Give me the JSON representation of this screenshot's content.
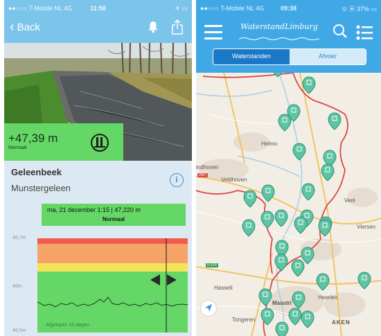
{
  "detail": {
    "status_bar": {
      "carrier": "●●○○○ T-Mobile NL  4G",
      "time": "11:58",
      "right": "✈ ▭"
    },
    "nav": {
      "back_label": "Back",
      "icons": [
        "bell-icon",
        "share-icon"
      ]
    },
    "level": {
      "value": "+47,39 m",
      "status": "Normaal"
    },
    "station": {
      "river": "Geleenbeek",
      "place": "Munstergeleen"
    },
    "tooltip": {
      "date_value": "ma, 21 december 1:15 |   47,220 m",
      "status": "Normaal"
    },
    "chart": {
      "y_labels": [
        "48,7m",
        "48m",
        "46,5m"
      ],
      "footer": "Afgelopen 10 dagen",
      "colors": {
        "red": "#f05b4e",
        "orange": "#f6a368",
        "yellow": "#f4e45a",
        "green": "#64d767"
      }
    }
  },
  "map_screen": {
    "status_bar": {
      "carrier": "●●○○○ T-Mobile NL  4G",
      "time": "09:38",
      "right": "⊙ ⦿ 37% ▭"
    },
    "logo": "WaterstandLimburg",
    "segments": [
      "Waterstanden",
      "Afvoer"
    ],
    "active_segment": "Waterstanden",
    "labels": {
      "helmond": "Helmo",
      "eindhoven": "indhoven",
      "veldhoven": "Veldhoven",
      "venlo": "Venl",
      "viersen": "Viersen",
      "hasselt": "Hasselt",
      "maastricht": "Maastri",
      "tongeren": "Tongeren",
      "aken": "AKEN",
      "heerlen": "Heerlen"
    },
    "roads": {
      "a67": "A67",
      "e314": "E314"
    },
    "accent": "#41a8e6"
  }
}
